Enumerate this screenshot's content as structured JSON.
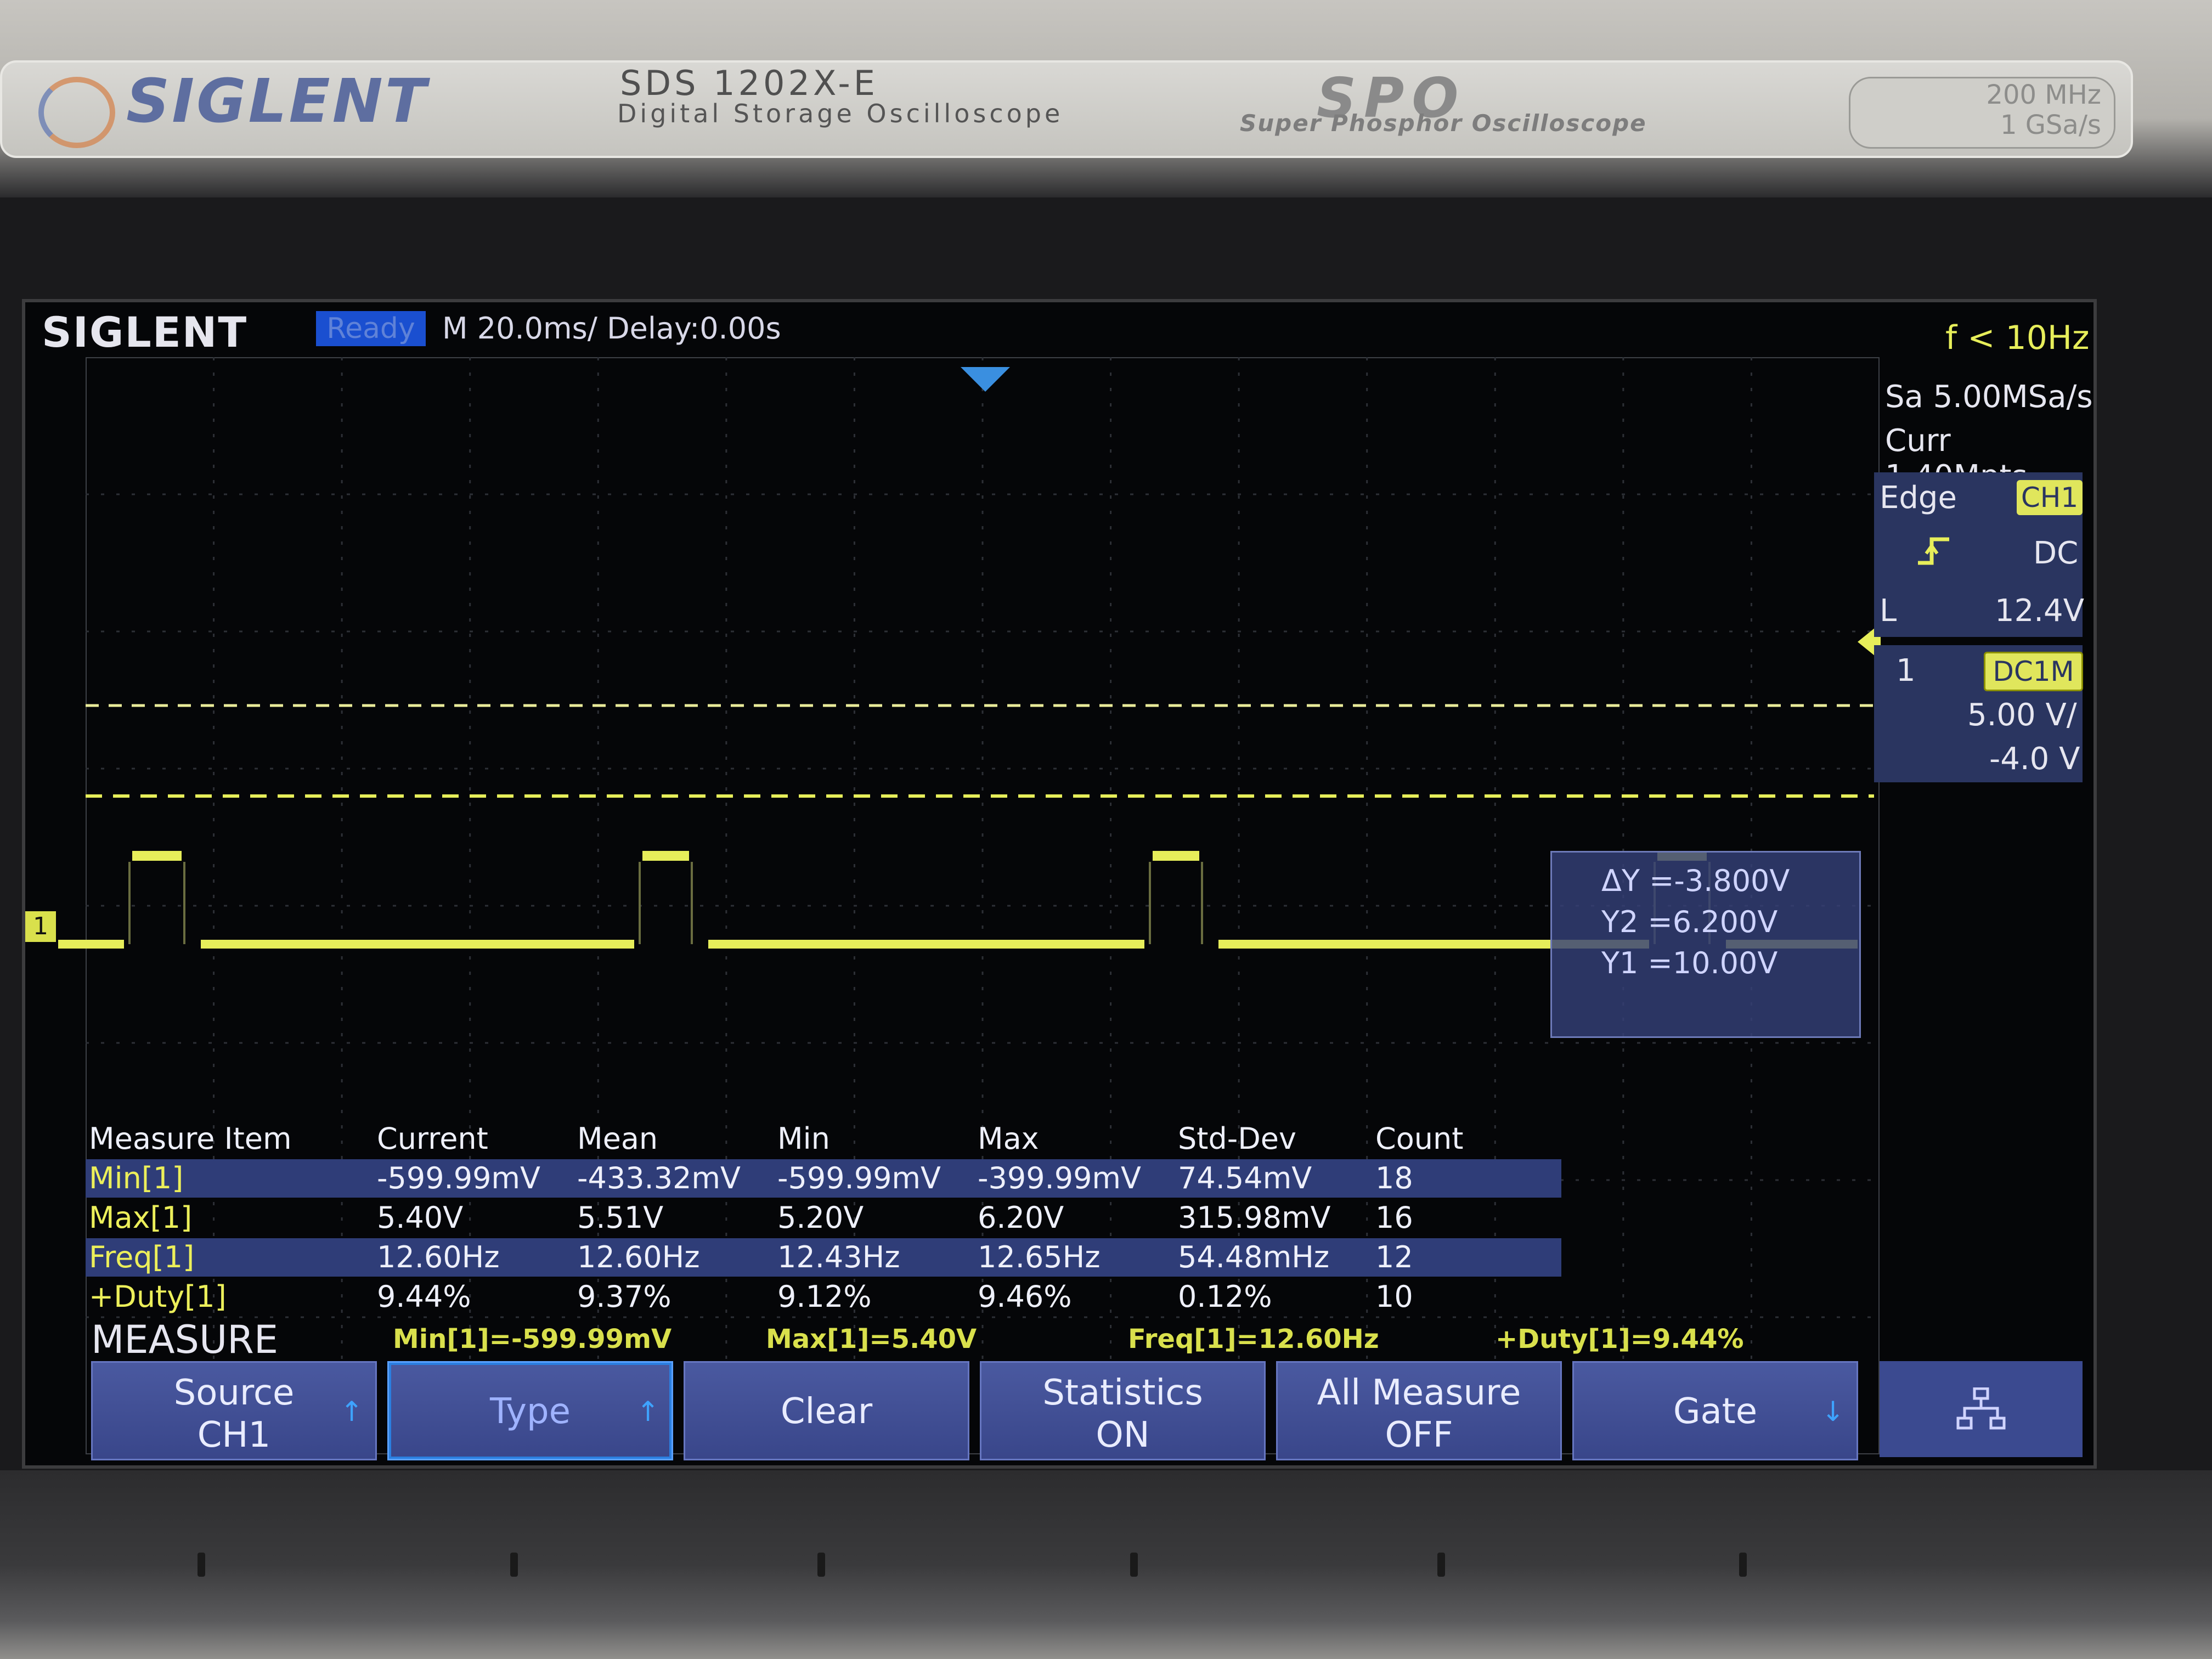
{
  "device": {
    "brand": "SIGLENT",
    "model": "SDS 1202X-E",
    "model_subtitle": "Digital Storage Oscilloscope",
    "spo_logo": "SPO",
    "spo_subtitle": "Super Phosphor Oscilloscope",
    "bandwidth": "200 MHz",
    "sample_rate_spec": "1 GSa/s"
  },
  "status": {
    "logo": "SIGLENT",
    "state": "Ready",
    "timebase": "M 20.0ms/ Delay:0.00s",
    "freq_indicator": "f < 10Hz"
  },
  "acquisition": {
    "sample_rate": "Sa 5.00MSa/s",
    "curr_points": "Curr 1.40Mpts"
  },
  "trigger": {
    "type": "Edge",
    "source": "CH1",
    "slope_icon": "rising-edge-icon",
    "coupling": "DC",
    "level_label": "L",
    "level": "12.4V"
  },
  "channel1": {
    "number": "1",
    "coupling_tag": "DC1M",
    "scale": "5.00 V/",
    "offset": "-4.0 V",
    "marker": "1"
  },
  "cursor_readout": {
    "delta_y": "ΔY =-3.800V",
    "y2": "Y2 =6.200V",
    "y1": "Y1 =10.00V"
  },
  "measure_table": {
    "headers": [
      "Measure Item",
      "Current",
      "Mean",
      "Min",
      "Max",
      "Std-Dev",
      "Count"
    ],
    "rows": [
      [
        "Min[1]",
        "-599.99mV",
        "-433.32mV",
        "-599.99mV",
        "-399.99mV",
        "74.54mV",
        "18"
      ],
      [
        "Max[1]",
        "5.40V",
        "5.51V",
        "5.20V",
        "6.20V",
        "315.98mV",
        "16"
      ],
      [
        "Freq[1]",
        "12.60Hz",
        "12.60Hz",
        "12.43Hz",
        "12.65Hz",
        "54.48mHz",
        "12"
      ],
      [
        "+Duty[1]",
        "9.44%",
        "9.37%",
        "9.12%",
        "9.46%",
        "0.12%",
        "10"
      ]
    ]
  },
  "measure_summary": {
    "title": "MEASURE",
    "items": [
      "Min[1]=-599.99mV",
      "Max[1]=5.40V",
      "Freq[1]=12.60Hz",
      "+Duty[1]=9.44%"
    ]
  },
  "softkeys": [
    {
      "line1": "Source",
      "line2": "CH1",
      "arrow": "↑"
    },
    {
      "line1": "Type",
      "line2": "",
      "arrow": "↑"
    },
    {
      "line1": "Clear",
      "line2": "",
      "arrow": ""
    },
    {
      "line1": "Statistics",
      "line2": "ON",
      "arrow": ""
    },
    {
      "line1": "All Measure",
      "line2": "OFF",
      "arrow": ""
    },
    {
      "line1": "Gate",
      "line2": "",
      "arrow": "↓"
    }
  ],
  "lan_icon": "network-icon",
  "waveform": {
    "channel": "CH1",
    "color": "#e7ee5a",
    "low_level_v": -0.6,
    "high_level_v": 5.4,
    "frequency_hz": 12.6,
    "duty_percent": 9.44
  },
  "colors": {
    "trace": "#e7ee5a",
    "menu_blue": "#39468a",
    "highlight_row": "#2f3d78",
    "ready_badge": "#1a4fd0"
  }
}
